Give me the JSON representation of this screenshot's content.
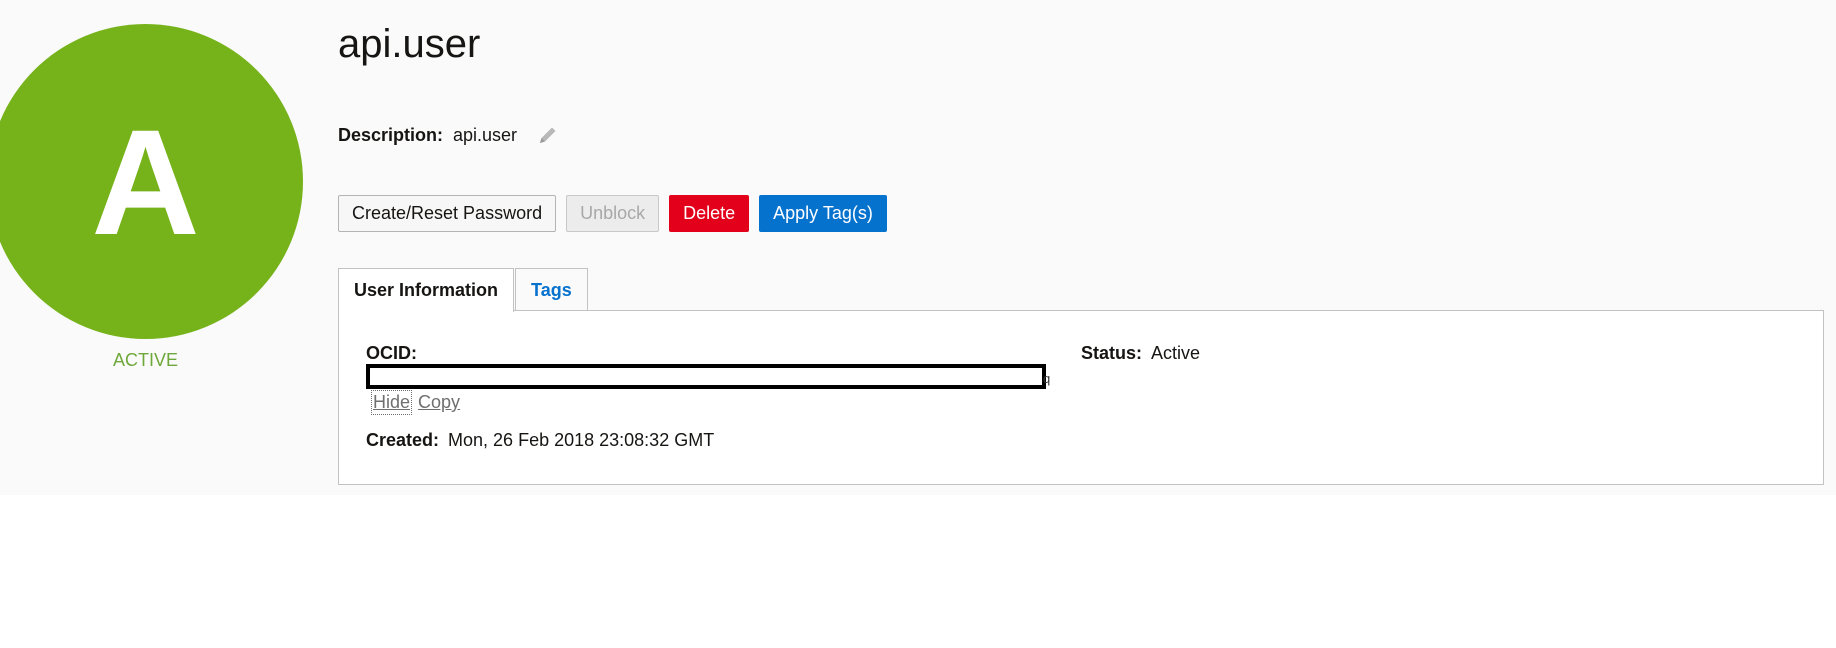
{
  "avatar": {
    "initial": "A",
    "status": "ACTIVE",
    "color": "#76b31b"
  },
  "header": {
    "title": "api.user"
  },
  "description": {
    "label": "Description:",
    "value": "api.user",
    "edit_icon": "pencil-icon"
  },
  "actions": {
    "create_reset_password": "Create/Reset Password",
    "unblock": "Unblock",
    "delete": "Delete",
    "apply_tags": "Apply Tag(s)"
  },
  "tabs": [
    {
      "label": "User Information",
      "active": true
    },
    {
      "label": "Tags",
      "active": false
    }
  ],
  "user_info": {
    "ocid_label": "OCID:",
    "ocid_tail": "q",
    "hide_label": "Hide",
    "copy_label": "Copy",
    "created_label": "Created:",
    "created_value": "Mon, 26 Feb 2018 23:08:32 GMT",
    "status_label": "Status:",
    "status_value": "Active"
  },
  "colors": {
    "primary": "#0572ce",
    "danger": "#e2001a",
    "active_green": "#76b31b"
  }
}
